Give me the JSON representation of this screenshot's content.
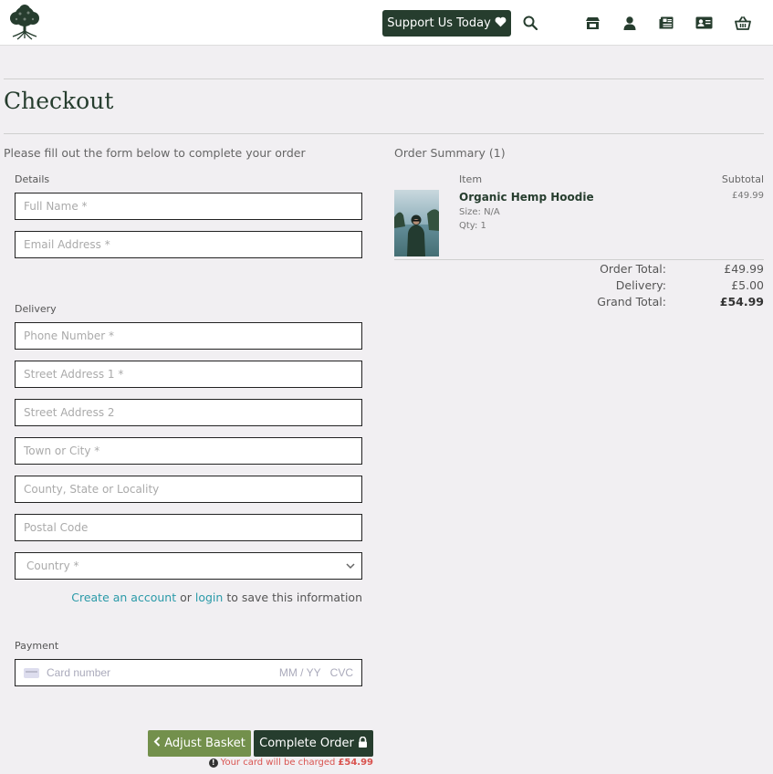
{
  "header": {
    "support_label": "Support Us Today",
    "icons": [
      "tree-logo",
      "search-icon",
      "shop-icon",
      "user-icon",
      "news-icon",
      "contact-card-icon",
      "basket-icon"
    ]
  },
  "page": {
    "title": "Checkout",
    "intro": "Please fill out the form below to complete your order"
  },
  "form": {
    "details_label": "Details",
    "full_name_placeholder": "Full Name *",
    "email_placeholder": "Email Address *",
    "delivery_label": "Delivery",
    "phone_placeholder": "Phone Number *",
    "street1_placeholder": "Street Address 1 *",
    "street2_placeholder": "Street Address 2",
    "town_placeholder": "Town or City *",
    "county_placeholder": "County, State or Locality",
    "postcode_placeholder": "Postal Code",
    "country_selected": "Country *",
    "create_account_link": "Create an account",
    "or_text": "or",
    "login_link": "login",
    "save_info_text": "to save this information",
    "payment_label": "Payment",
    "card_number_placeholder": "Card number",
    "card_expiry_placeholder": "MM / YY",
    "card_cvc_placeholder": "CVC"
  },
  "actions": {
    "adjust_label": "Adjust Basket",
    "complete_label": "Complete Order",
    "charge_text": "Your card will be charged",
    "charge_amount": "£54.99"
  },
  "summary": {
    "title": "Order Summary (1)",
    "col_item": "Item",
    "col_subtotal": "Subtotal",
    "product": {
      "name": "Organic Hemp Hoodie",
      "size": "Size: N/A",
      "qty": "Qty: 1",
      "price": "£49.99"
    },
    "order_total_label": "Order Total:",
    "order_total": "£49.99",
    "delivery_label": "Delivery:",
    "delivery": "£5.00",
    "grand_total_label": "Grand Total:",
    "grand_total": "£54.99"
  },
  "colors": {
    "primary": "#263d2e",
    "secondary": "#73904c",
    "link": "#2a9aa8",
    "warning": "#d9534f"
  }
}
